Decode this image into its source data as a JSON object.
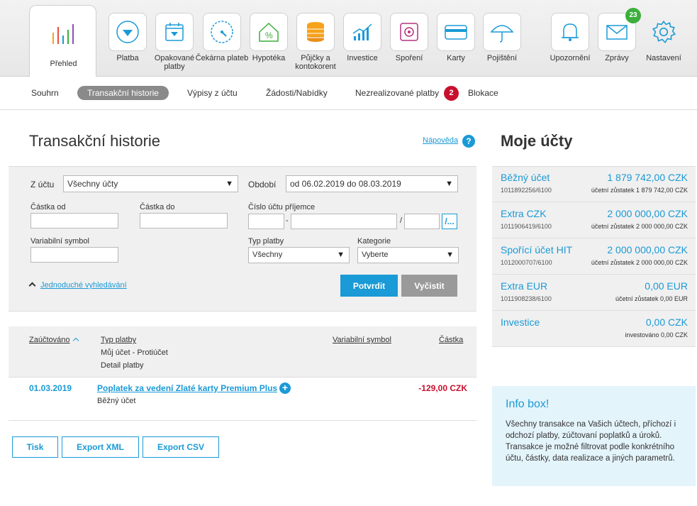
{
  "top_nav": {
    "home": {
      "label": "Přehled"
    },
    "items": [
      {
        "label": "Platba",
        "icon": "arrow-down-icon"
      },
      {
        "label": "Opakované platby",
        "icon": "calendar-icon"
      },
      {
        "label": "Čekárna plateb",
        "icon": "dial-icon"
      },
      {
        "label": "Hypotéka",
        "icon": "house-percent-icon"
      },
      {
        "label": "Půjčky a kontokorent",
        "icon": "coins-icon"
      },
      {
        "label": "Investice",
        "icon": "growth-chart-icon"
      },
      {
        "label": "Spoření",
        "icon": "safe-icon"
      },
      {
        "label": "Karty",
        "icon": "card-icon"
      },
      {
        "label": "Pojištění",
        "icon": "umbrella-icon"
      }
    ],
    "notifications": {
      "label": "Upozornění",
      "icon": "bell-icon"
    },
    "messages": {
      "label": "Zprávy",
      "icon": "envelope-icon",
      "count": "23"
    },
    "settings": {
      "label": "Nastavení",
      "icon": "gear-icon"
    }
  },
  "sub_nav": {
    "items": [
      "Souhrn",
      "Transakční historie",
      "Výpisy z účtu",
      "Žádosti/Nabídky",
      "Nezrealizované platby",
      "Blokace"
    ],
    "unrealized_count": "2"
  },
  "main": {
    "title": "Transakční historie",
    "help_link": "Nápověda",
    "help_icon": "?"
  },
  "filter": {
    "from_account_label": "Z účtu",
    "from_account_value": "Všechny účty",
    "period_label": "Období",
    "period_value": "od 06.02.2019 do 08.03.2019",
    "amount_from_label": "Částka od",
    "amount_to_label": "Částka do",
    "recipient_account_label": "Číslo účtu příjemce",
    "recipient_dash": "-",
    "recipient_slash": "/",
    "browse_button": "/...",
    "variable_symbol_label": "Variabilní symbol",
    "payment_type_label": "Typ platby",
    "payment_type_value": "Všechny",
    "category_label": "Kategorie",
    "category_value": "Vyberte",
    "simple_search_link": "Jednoduché vyhledávání",
    "confirm_button": "Potvrdit",
    "clear_button": "Vyčistit",
    "arrow": "▼",
    "caret_up": "^"
  },
  "table": {
    "col_booked": "Zaúčtováno",
    "col_type": "Typ platby",
    "col_type_sub1": "Můj účet - Protiúčet",
    "col_type_sub2": "Detail platby",
    "col_vs": "Variabilní symbol",
    "col_amount": "Částka",
    "rows": [
      {
        "date": "01.03.2019",
        "description": "Poplatek za vedení Zlaté karty Premium Plus",
        "account": "Běžný účet",
        "amount": "-129,00 CZK"
      }
    ]
  },
  "export": {
    "print": "Tisk",
    "xml": "Export XML",
    "csv": "Export CSV"
  },
  "accounts": {
    "title": "Moje účty",
    "items": [
      {
        "name": "Běžný účet",
        "balance": "1 879 742,00 CZK",
        "number": "1011892256/6100",
        "note": "účetní zůstatek 1 879 742,00 CZK"
      },
      {
        "name": "Extra CZK",
        "balance": "2 000 000,00 CZK",
        "number": "1011906419/6100",
        "note": "účetní zůstatek 2 000 000,00 CZK"
      },
      {
        "name": "Spořící účet HIT",
        "balance": "2 000 000,00 CZK",
        "number": "1012000707/6100",
        "note": "účetní zůstatek 2 000 000,00 CZK"
      },
      {
        "name": "Extra EUR",
        "balance": "0,00 EUR",
        "number": "1011908238/6100",
        "note": "účetní zůstatek 0,00 EUR"
      },
      {
        "name": "Investice",
        "balance": "0,00 CZK",
        "number": "",
        "note": "investováno 0,00 CZK"
      }
    ]
  },
  "info_box": {
    "title": "Info box!",
    "text": "Všechny transakce na Vašich účtech, příchozí i odchozí platby, zúčtovaní poplatků a úroků. Transakce je možné filtrovat podle konkrétního účtu, částky, data realizace a jiných parametrů."
  },
  "colors": {
    "accent": "#1a9ad6",
    "negative": "#c8102e",
    "badge_green": "#3cae3c"
  }
}
